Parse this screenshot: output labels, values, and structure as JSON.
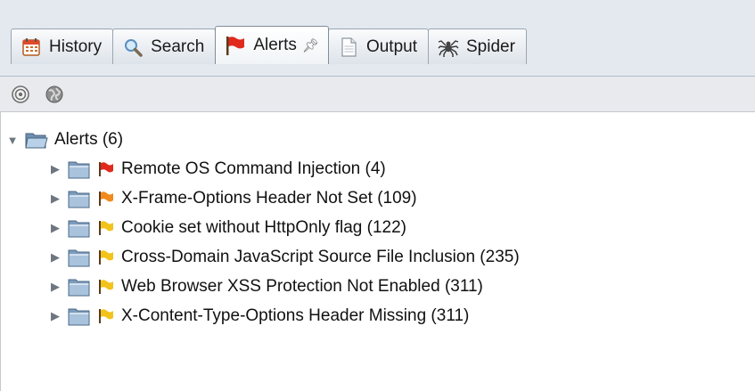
{
  "tabs": [
    {
      "label": "History",
      "icon": "calendar-icon",
      "active": false
    },
    {
      "label": "Search",
      "icon": "magnifier-icon",
      "active": false
    },
    {
      "label": "Alerts",
      "icon": "flag-icon",
      "active": true,
      "pinned": true
    },
    {
      "label": "Output",
      "icon": "document-icon",
      "active": false
    },
    {
      "label": "Spider",
      "icon": "spider-icon",
      "active": false
    }
  ],
  "toolbar": {
    "buttons": [
      "target-icon",
      "globe-icon"
    ]
  },
  "tree": {
    "root": {
      "label": "Alerts (6)",
      "expanded": true
    },
    "items": [
      {
        "label": "Remote OS Command Injection (4)",
        "risk": "high",
        "flag_color": "#e02a1e"
      },
      {
        "label": "X-Frame-Options Header Not Set (109)",
        "risk": "medium",
        "flag_color": "#f08a1c"
      },
      {
        "label": "Cookie set without HttpOnly flag (122)",
        "risk": "low",
        "flag_color": "#f2c31b"
      },
      {
        "label": "Cross-Domain JavaScript Source File Inclusion (235)",
        "risk": "low",
        "flag_color": "#f2c31b"
      },
      {
        "label": "Web Browser XSS Protection Not Enabled (311)",
        "risk": "low",
        "flag_color": "#f2c31b"
      },
      {
        "label": "X-Content-Type-Options Header Missing (311)",
        "risk": "low",
        "flag_color": "#f2c31b"
      }
    ]
  },
  "colors": {
    "tabbar_bg": "#e3e9ef",
    "folder": "#8fb2d4",
    "high_risk_flag": "#e02a1e",
    "medium_risk_flag": "#f08a1c",
    "low_risk_flag": "#f2c31b"
  }
}
